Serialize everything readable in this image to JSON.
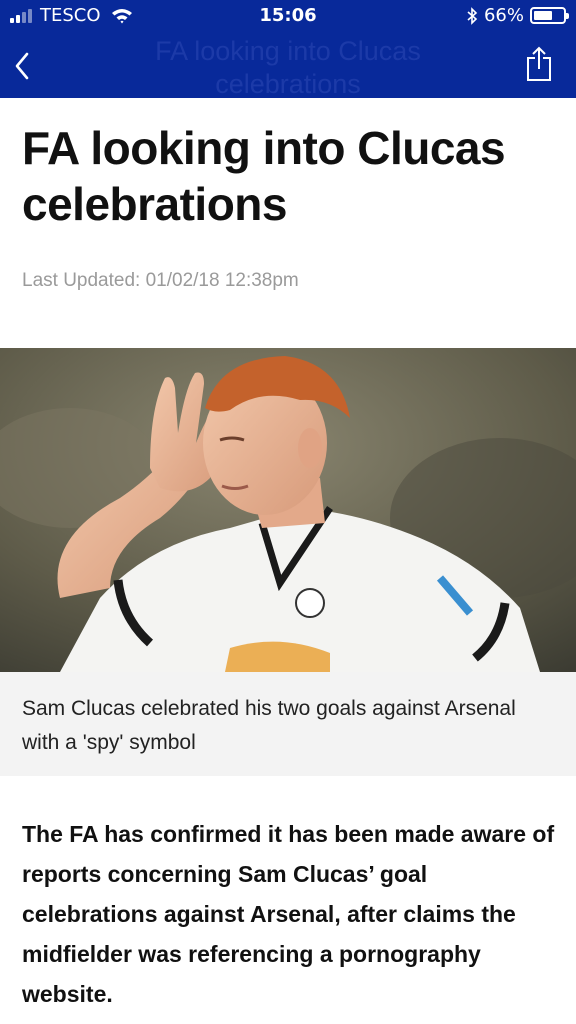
{
  "status_bar": {
    "carrier": "TESCO",
    "time": "15:06",
    "battery_percent": "66%",
    "battery_level": 0.66
  },
  "nav": {
    "title": "FA looking into Clucas celebrations",
    "back_icon": "chevron-left-icon",
    "share_icon": "share-icon"
  },
  "article": {
    "headline": "FA looking into Clucas celebrations",
    "last_updated": "Last Updated: 01/02/18 12:38pm",
    "image_caption": "Sam Clucas celebrated his two goals against Arsenal with a 'spy' symbol",
    "lead": "The FA has confirmed it has been made aware of reports concerning Sam Clucas’ goal celebrations against Arsenal, after claims the midfielder was referencing a pornography website."
  },
  "colors": {
    "header_bg": "#08299a",
    "caption_bg": "#f3f3f3"
  }
}
